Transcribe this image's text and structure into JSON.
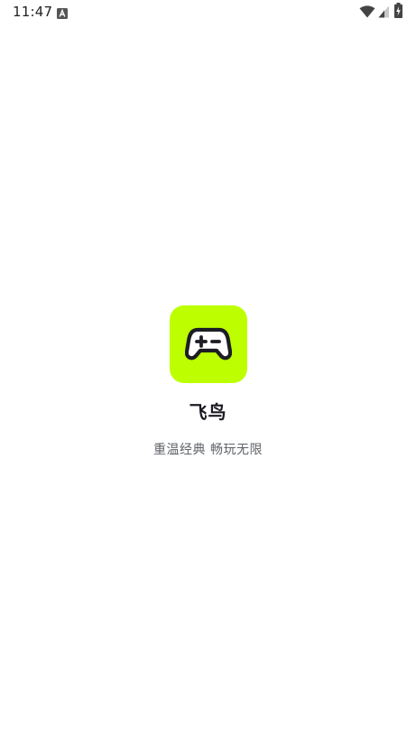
{
  "status_bar": {
    "time": "11:47",
    "icons": [
      "notification-a-icon",
      "wifi-icon",
      "cell-signal-icon",
      "battery-charging-icon"
    ]
  },
  "splash": {
    "app_name": "飞鸟",
    "tagline": "重温经典 畅玩无限",
    "icon": "gamepad-icon"
  },
  "colors": {
    "background": "#ffffff",
    "app_icon_bg": "#bdff00",
    "icon_stroke": "#1d1d24",
    "title_text": "#1a1a22",
    "tagline_text": "#5f6368"
  }
}
